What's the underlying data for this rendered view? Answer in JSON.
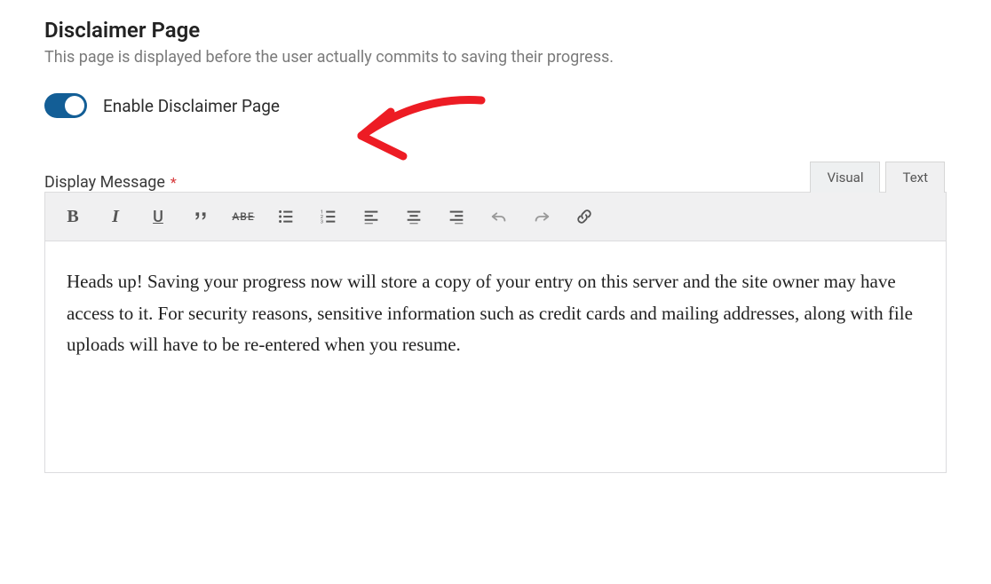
{
  "heading": "Disclaimer Page",
  "description": "This page is displayed before the user actually commits to saving their progress.",
  "toggle": {
    "label": "Enable Disclaimer Page",
    "enabled": true
  },
  "field": {
    "label": "Display Message",
    "required_marker": "*"
  },
  "tabs": {
    "visual": "Visual",
    "text": "Text",
    "active": "visual"
  },
  "toolbar": {
    "bold": "B",
    "italic": "I",
    "underline": "U",
    "blockquote": "❝",
    "strike": "ABE"
  },
  "editor": {
    "content": "Heads up! Saving your progress now will store a copy of your entry on this server and the site owner may have access to it. For security reasons, sensitive information such as credit cards and mailing addresses, along with file uploads will have to be re-entered when you resume."
  },
  "colors": {
    "accent": "#135e96",
    "annotation": "#ed1c24"
  }
}
